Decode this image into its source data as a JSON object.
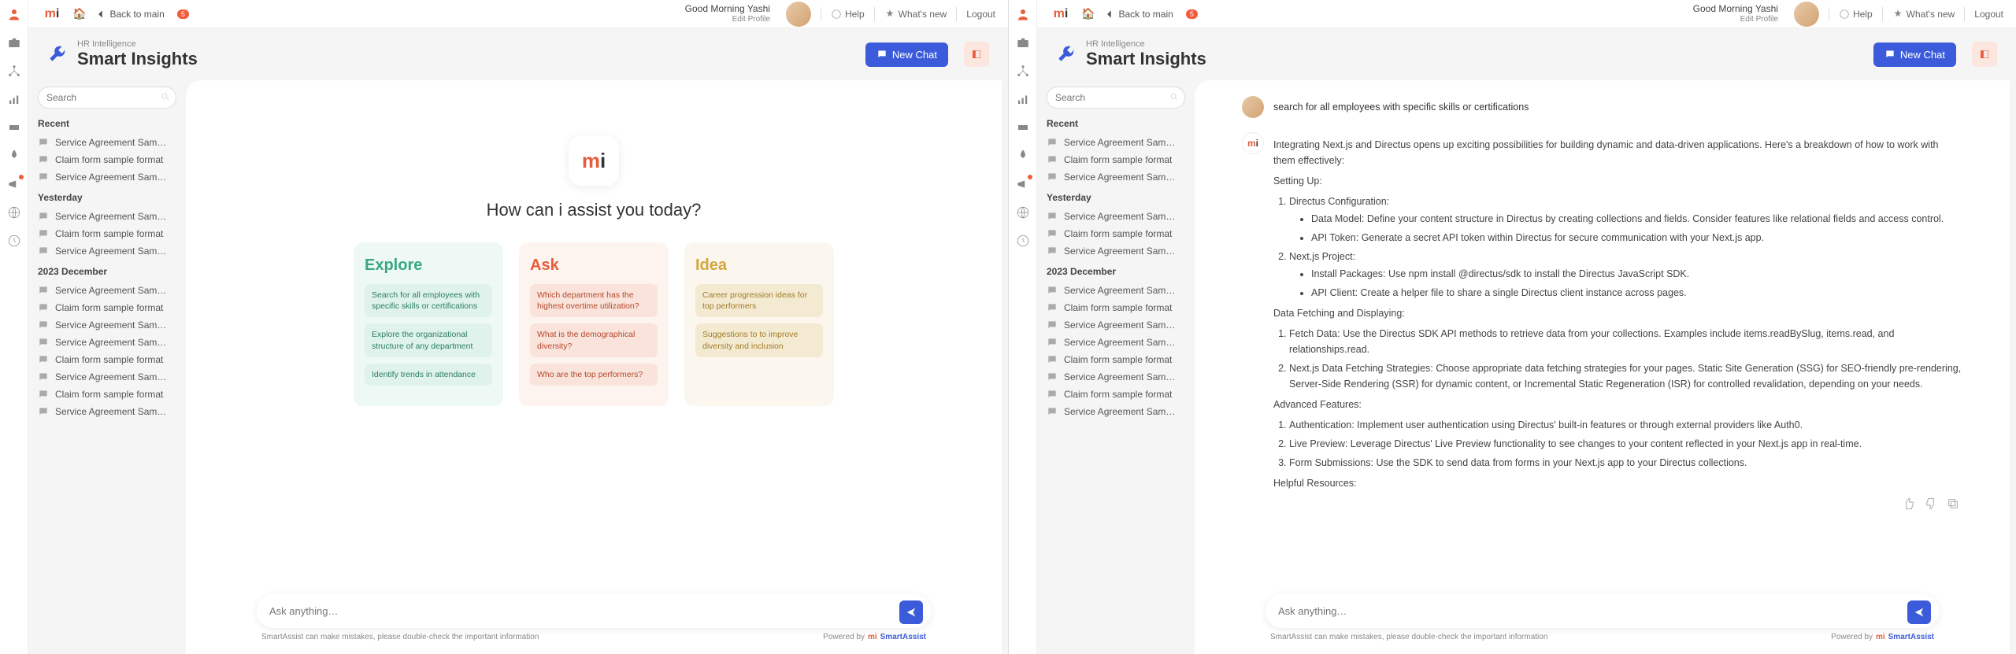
{
  "topbar": {
    "back": "Back to main",
    "badge": "5",
    "greeting": "Good Morning Yashi",
    "edit_profile": "Edit Profile",
    "help": "Help",
    "whats_new": "What's new",
    "logout": "Logout"
  },
  "header": {
    "sup": "HR Intelligence",
    "title": "Smart Insights",
    "new_chat": "New Chat"
  },
  "search": {
    "placeholder": "Search"
  },
  "sidepanel": {
    "groups": [
      {
        "title": "Recent",
        "items": [
          "Service Agreement Sam…",
          "Claim form sample format",
          "Service Agreement Sam…"
        ]
      },
      {
        "title": "Yesterday",
        "items": [
          "Service Agreement Sam…",
          "Claim form sample format",
          "Service Agreement Sam…"
        ]
      },
      {
        "title": "2023 December",
        "items": [
          "Service Agreement Sam…",
          "Claim form sample format",
          "Service Agreement Sam…",
          "Service Agreement Sam…",
          "Claim form sample format",
          "Service Agreement Sam…",
          "Claim form sample format",
          "Service Agreement Sam…"
        ]
      }
    ]
  },
  "landing": {
    "title": "How can i assist you today?",
    "cards": [
      {
        "kind": "explore",
        "title": "Explore",
        "pills": [
          "Search for all employees with specific skills or certifications",
          "Explore the organizational structure of any department",
          "Identify trends in attendance"
        ]
      },
      {
        "kind": "ask",
        "title": "Ask",
        "pills": [
          "Which department has the highest overtime utilization?",
          "What is the demographical diversity?",
          "Who are the top performers?"
        ]
      },
      {
        "kind": "idea",
        "title": "Idea",
        "pills": [
          "Career progression ideas for top performers",
          "Suggestions to to improve diversity and inclusion"
        ]
      }
    ]
  },
  "input": {
    "placeholder": "Ask anything…"
  },
  "footer": {
    "disclaimer": "SmartAssist can make mistakes, please double-check the important information",
    "powered": "Powered by",
    "brand": "SmartAssist"
  },
  "conversation": {
    "user_query": "search for all employees with specific skills or certifications",
    "bot_intro": "Integrating Next.js and Directus opens up exciting possibilities for building dynamic and data-driven applications. Here's a breakdown of how to work with them effectively:",
    "setting_up": "Setting Up:",
    "setup_list": [
      {
        "title": "Directus Configuration:",
        "bullets": [
          "Data Model: Define your content structure in Directus by creating collections and fields. Consider features like relational fields and access control.",
          "API Token: Generate a secret API token within Directus for secure communication with your Next.js app."
        ]
      },
      {
        "title": "Next.js Project:",
        "bullets": [
          "Install Packages: Use npm install @directus/sdk to install the Directus JavaScript SDK.",
          "API Client: Create a helper file to share a single Directus client instance across pages."
        ]
      }
    ],
    "fetching_title": "Data Fetching and Displaying:",
    "fetching_list": [
      "Fetch Data: Use the Directus SDK API methods to retrieve data from your collections. Examples include items.readBySlug, items.read, and relationships.read.",
      "Next.js Data Fetching Strategies: Choose appropriate data fetching strategies for your pages. Static Site Generation (SSG) for SEO-friendly pre-rendering, Server-Side Rendering (SSR) for dynamic content, or Incremental Static Regeneration (ISR) for controlled revalidation, depending on your needs."
    ],
    "advanced_title": "Advanced Features:",
    "advanced_list": [
      "Authentication: Implement user authentication using Directus' built-in features or through external providers like Auth0.",
      "Live Preview: Leverage Directus' Live Preview functionality to see changes to your content reflected in your Next.js app in real-time.",
      "Form Submissions: Use the SDK to send data from forms in your Next.js app to your Directus collections."
    ],
    "helpful": "Helpful Resources:"
  }
}
